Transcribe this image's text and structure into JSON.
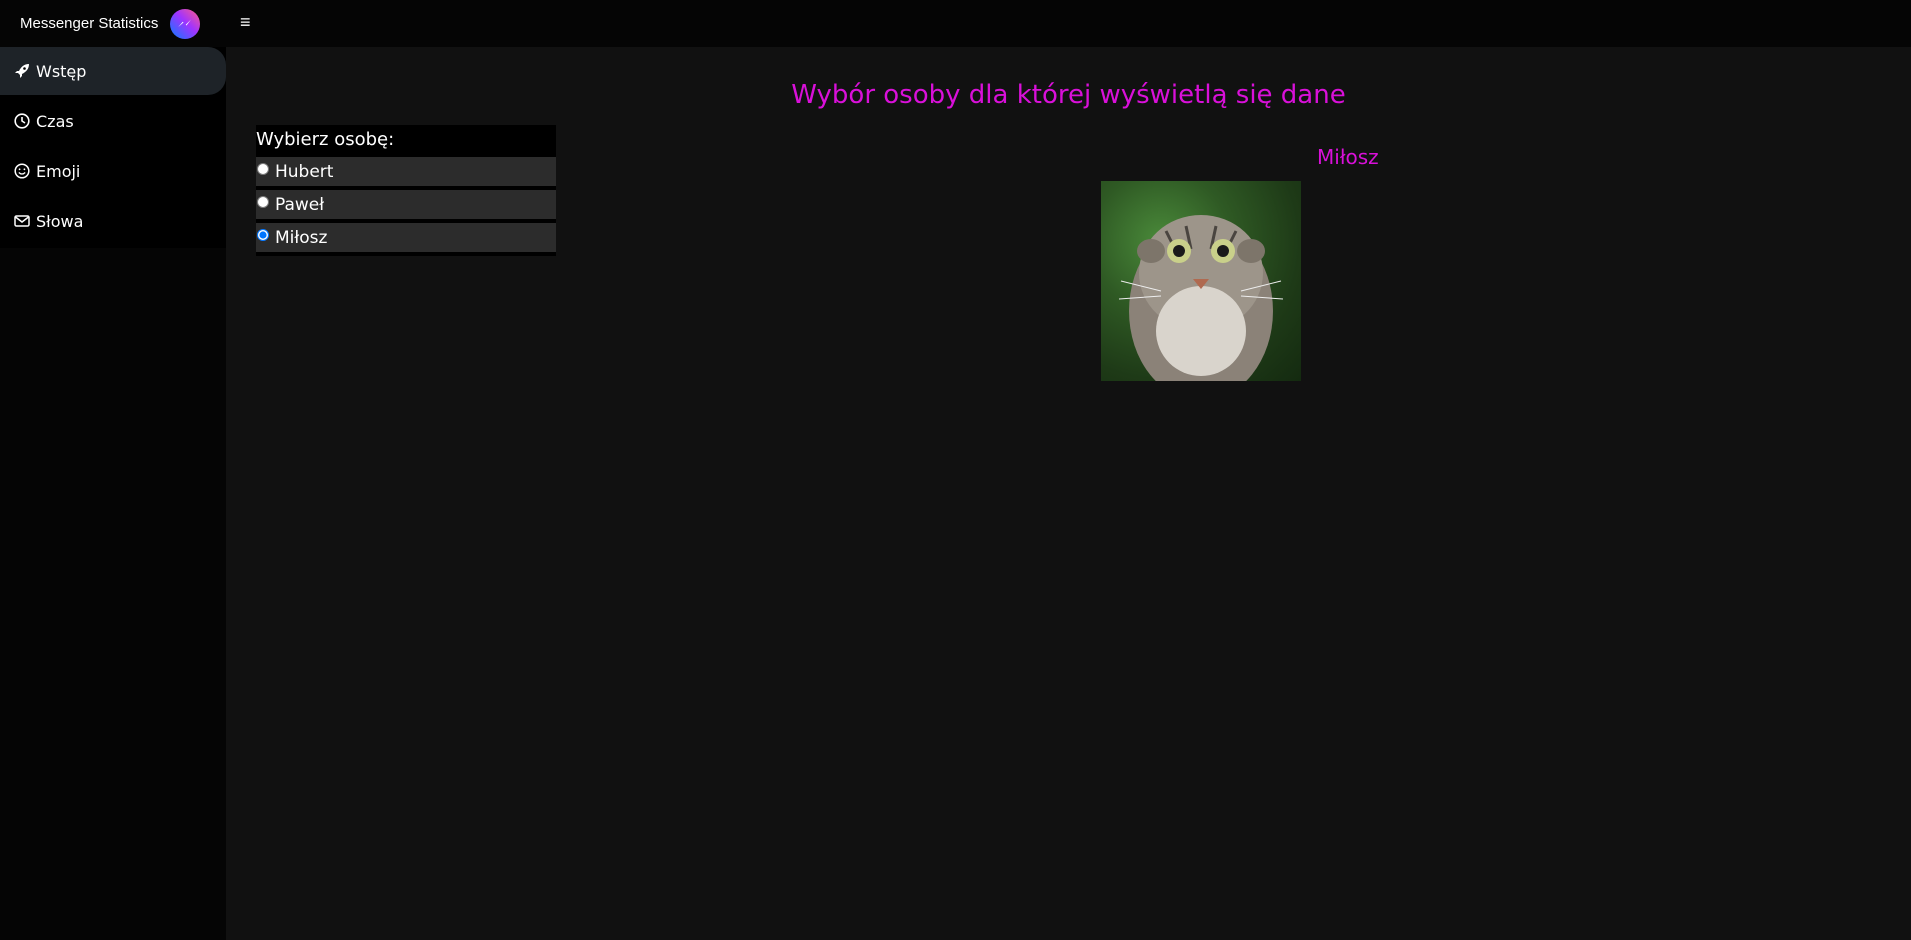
{
  "header": {
    "brand_title": "Messenger Statistics",
    "brand_logo_icon": "messenger-icon",
    "menu_icon": "hamburger-icon"
  },
  "sidebar": {
    "items": [
      {
        "label": "Wstęp",
        "icon": "rocket-icon",
        "active": true
      },
      {
        "label": "Czas",
        "icon": "clock-icon",
        "active": false
      },
      {
        "label": "Emoji",
        "icon": "smile-icon",
        "active": false
      },
      {
        "label": "Słowa",
        "icon": "envelope-icon",
        "active": false
      }
    ]
  },
  "main": {
    "title": "Wybór osoby dla której wyświetlą się dane",
    "selector": {
      "label": "Wybierz osobę:",
      "options": [
        "Hubert",
        "Paweł",
        "Miłosz"
      ],
      "selected": "Miłosz"
    },
    "person": {
      "name": "Miłosz"
    }
  },
  "colors": {
    "accent": "#d910d9",
    "background": "#111111",
    "sidebar": "#050505",
    "active_item": "#1e2328"
  }
}
